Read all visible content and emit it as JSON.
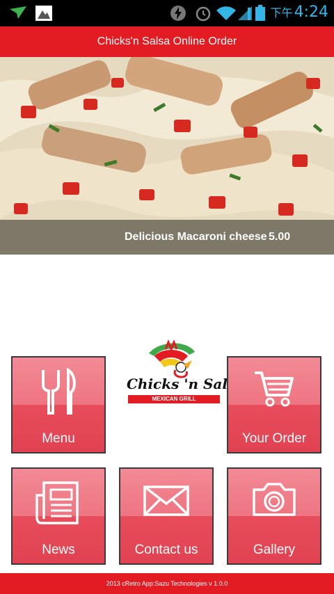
{
  "status_bar": {
    "time": "4:24",
    "time_prefix": "下午",
    "icons": [
      "navigation-icon",
      "image-icon",
      "flash-icon",
      "alarm-icon",
      "wifi-icon",
      "signal-icon",
      "battery-icon"
    ]
  },
  "title_bar": {
    "title": "Chicks'n Salsa Online Order"
  },
  "banner": {
    "item_name": "Delicious Macaroni cheese",
    "item_price": "5.00"
  },
  "logo": {
    "brand": "Chicks 'n Salsa",
    "tagline": "MEXICAN GRILL"
  },
  "tiles": [
    {
      "label": "Menu",
      "icon": "fork-knife-icon"
    },
    {
      "label": "Your Order",
      "icon": "cart-icon"
    },
    {
      "label": "News",
      "icon": "newspaper-icon"
    },
    {
      "label": "Contact us",
      "icon": "envelope-icon"
    },
    {
      "label": "Gallery",
      "icon": "camera-icon"
    }
  ],
  "footer": {
    "text": "2013 cRetro App:Sazu Technologies v 1.0.0"
  },
  "colors": {
    "brand_red": "#e31b23",
    "tile_pink": "#ee7581",
    "status_blue": "#33b5e5"
  }
}
